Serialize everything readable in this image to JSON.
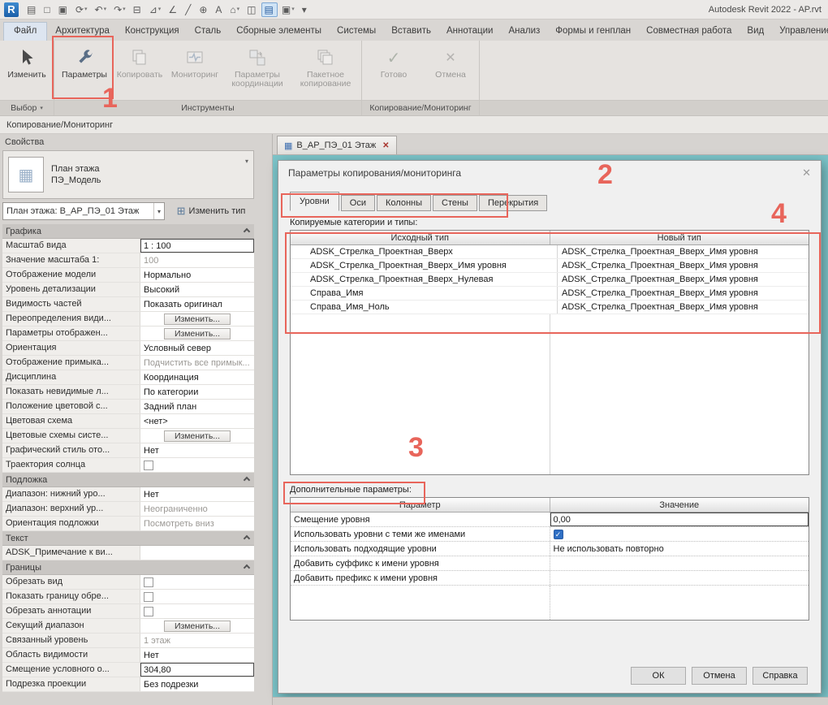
{
  "colors": {
    "accent": "#e8655b",
    "teal": "#7cc4c9",
    "check_blue": "#2f6fc4"
  },
  "icons": {
    "check": "✓",
    "close": "✕",
    "dropdown": "▾",
    "grid": "▦",
    "plus_grid": "⊞"
  },
  "titlebar": {
    "logo_letter": "R",
    "title": "Autodesk Revit 2022 - AP.rvt",
    "icons": [
      {
        "name": "file-list-icon",
        "glyph": "▤"
      },
      {
        "name": "open-icon",
        "glyph": "□"
      },
      {
        "name": "save-icon",
        "glyph": "▣"
      },
      {
        "name": "sync-icon",
        "glyph": "⟳",
        "dd": "▾"
      },
      {
        "name": "undo-icon",
        "glyph": "↶",
        "dd": "▾"
      },
      {
        "name": "redo-icon",
        "glyph": "↷",
        "dd": "▾"
      },
      {
        "name": "print-icon",
        "glyph": "⊟"
      },
      {
        "name": "measure-icon",
        "glyph": "⊿",
        "dd": "▾"
      },
      {
        "name": "dimension-icon",
        "glyph": "∠"
      },
      {
        "name": "line-icon",
        "glyph": "╱"
      },
      {
        "name": "zoom-icon",
        "glyph": "⊕"
      },
      {
        "name": "text-icon",
        "glyph": "A"
      },
      {
        "name": "default-3d-view-icon",
        "glyph": "⌂",
        "dd": "▾"
      },
      {
        "name": "section-icon",
        "glyph": "◫"
      },
      {
        "name": "thin-lines-icon",
        "glyph": "▤",
        "cls": "active"
      },
      {
        "name": "switch-windows-icon",
        "glyph": "▣",
        "dd": "▾"
      },
      {
        "name": "customize-qat-icon",
        "glyph": "▾"
      }
    ]
  },
  "ribbon": {
    "tabs": [
      {
        "name": "ribbon-tab-file",
        "label": "Файл",
        "cls": "file"
      },
      {
        "name": "ribbon-tab-architecture",
        "label": "Архитектура"
      },
      {
        "name": "ribbon-tab-structure",
        "label": "Конструкция"
      },
      {
        "name": "ribbon-tab-steel",
        "label": "Сталь"
      },
      {
        "name": "ribbon-tab-precast",
        "label": "Сборные элементы"
      },
      {
        "name": "ribbon-tab-systems",
        "label": "Системы"
      },
      {
        "name": "ribbon-tab-insert",
        "label": "Вставить"
      },
      {
        "name": "ribbon-tab-annotate",
        "label": "Аннотации"
      },
      {
        "name": "ribbon-tab-analyze",
        "label": "Анализ"
      },
      {
        "name": "ribbon-tab-massing",
        "label": "Формы и генплан"
      },
      {
        "name": "ribbon-tab-collaborate",
        "label": "Совместная работа"
      },
      {
        "name": "ribbon-tab-view",
        "label": "Вид"
      },
      {
        "name": "ribbon-tab-manage",
        "label": "Управление"
      }
    ],
    "buttons": {
      "modify": "Изменить",
      "options": "Параметры",
      "copy": "Копировать",
      "monitor": "Мониторинг",
      "coordination": "Параметры координации",
      "batch": "Пакетное копирование",
      "finish": "Готово",
      "cancel": "Отмена"
    },
    "panels": {
      "select": "Выбор",
      "tools": "Инструменты",
      "copy_monitor": "Копирование/Мониторинг"
    }
  },
  "breadcrumb": "Копирование/Мониторинг",
  "properties": {
    "header": "Свойства",
    "type_name": "План этажа",
    "type_family": "ПЭ_Модель",
    "selector": "План этажа: В_АР_ПЭ_01 Этаж",
    "edit_type": "Изменить тип",
    "grid": [
      {
        "cls": "head",
        "label": "Графика"
      },
      {
        "cls": "sel",
        "label": "Масштаб вида",
        "value": "1 : 100"
      },
      {
        "cls": "gray",
        "label": "Значение масштаба 1:",
        "value": "100"
      },
      {
        "label": "Отображение модели",
        "value": "Нормально"
      },
      {
        "label": "Уровень детализации",
        "value": "Высокий"
      },
      {
        "label": "Видимость частей",
        "value": "Показать оригинал"
      },
      {
        "cls": "btn",
        "label": "Переопределения види...",
        "value": "Изменить..."
      },
      {
        "cls": "btn",
        "label": "Параметры отображен...",
        "value": "Изменить..."
      },
      {
        "label": "Ориентация",
        "value": "Условный север"
      },
      {
        "cls": "gray",
        "label": "Отображение примыка...",
        "value": "Подчистить все примык..."
      },
      {
        "label": "Дисциплина",
        "value": "Координация"
      },
      {
        "label": "Показать невидимые л...",
        "value": "По категории"
      },
      {
        "label": "Положение цветовой с...",
        "value": "Задний план"
      },
      {
        "label": "Цветовая схема",
        "value": "<нет>"
      },
      {
        "cls": "btn",
        "label": "Цветовые схемы систе...",
        "value": "Изменить..."
      },
      {
        "label": "Графический стиль ото...",
        "value": "Нет"
      },
      {
        "cls": "check",
        "label": "Траектория солнца",
        "value": ""
      },
      {
        "cls": "head",
        "label": "Подложка"
      },
      {
        "label": "Диапазон: нижний уро...",
        "value": "Нет"
      },
      {
        "cls": "gray",
        "label": "Диапазон: верхний ур...",
        "value": "Неограниченно"
      },
      {
        "cls": "gray",
        "label": "Ориентация подложки",
        "value": "Посмотреть вниз"
      },
      {
        "cls": "head",
        "label": "Текст"
      },
      {
        "label": "ADSK_Примечание к ви...",
        "value": ""
      },
      {
        "cls": "head",
        "label": "Границы"
      },
      {
        "cls": "check",
        "label": "Обрезать вид",
        "value": ""
      },
      {
        "cls": "check",
        "label": "Показать границу обре...",
        "value": ""
      },
      {
        "cls": "check",
        "label": "Обрезать аннотации",
        "value": ""
      },
      {
        "cls": "btn",
        "label": "Секущий диапазон",
        "value": "Изменить..."
      },
      {
        "cls": "gray",
        "label": "Связанный уровень",
        "value": "1 этаж"
      },
      {
        "label": "Область видимости",
        "value": "Нет"
      },
      {
        "cls": "sel",
        "label": "Смещение условного о...",
        "value": "304,80"
      },
      {
        "label": "Подрезка проекции",
        "value": "Без подрезки"
      }
    ]
  },
  "view_tab": {
    "label": "В_АР_ПЭ_01 Этаж"
  },
  "dialog": {
    "title": "Параметры копирования/мониторинга",
    "tabs": [
      {
        "name": "dialog-tab-levels",
        "label": "Уровни",
        "cls": "active"
      },
      {
        "name": "dialog-tab-grids",
        "label": "Оси"
      },
      {
        "name": "dialog-tab-columns",
        "label": "Колонны"
      },
      {
        "name": "dialog-tab-walls",
        "label": "Стены"
      },
      {
        "name": "dialog-tab-floors",
        "label": "Перекрытия"
      }
    ],
    "categories_label": "Копируемые категории и типы:",
    "types_table": {
      "headers": [
        "Исходный тип",
        "Новый тип"
      ],
      "rows": [
        {
          "src": "ADSK_Стрелка_Проектная_Вверх",
          "dst": "ADSK_Стрелка_Проектная_Вверх_Имя уровня"
        },
        {
          "src": "ADSK_Стрелка_Проектная_Вверх_Имя уровня",
          "dst": "ADSK_Стрелка_Проектная_Вверх_Имя уровня"
        },
        {
          "src": "ADSK_Стрелка_Проектная_Вверх_Нулевая",
          "dst": "ADSK_Стрелка_Проектная_Вверх_Имя уровня"
        },
        {
          "src": "Справа_Имя",
          "dst": "ADSK_Стрелка_Проектная_Вверх_Имя уровня"
        },
        {
          "src": "Справа_Имя_Ноль",
          "dst": "ADSK_Стрелка_Проектная_Вверх_Имя уровня"
        }
      ]
    },
    "additional_label": "Дополнительные параметры:",
    "params_table": {
      "headers": [
        "Параметр",
        "Значение"
      ],
      "rows": [
        {
          "cls": "sel",
          "param": "Смещение уровня",
          "value": "0,00"
        },
        {
          "cls": "check",
          "param": "Использовать уровни с теми же именами",
          "value": ""
        },
        {
          "param": "Использовать подходящие уровни",
          "value": "Не использовать повторно"
        },
        {
          "param": "Добавить суффикс к имени уровня",
          "value": ""
        },
        {
          "param": "Добавить префикс к имени уровня",
          "value": ""
        }
      ]
    },
    "buttons": {
      "ok": "ОК",
      "cancel": "Отмена",
      "help": "Справка"
    }
  },
  "annotations": {
    "n1": "1",
    "n2": "2",
    "n3": "3",
    "n4": "4"
  }
}
